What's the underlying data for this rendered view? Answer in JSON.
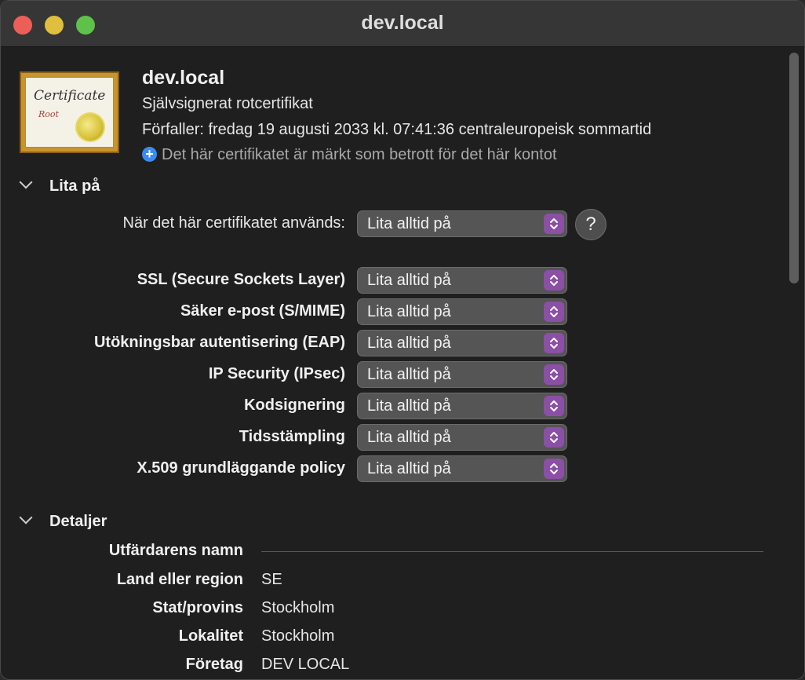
{
  "window": {
    "title": "dev.local"
  },
  "certificate": {
    "icon_title": "Certificate",
    "icon_subtitle": "Root",
    "name": "dev.local",
    "kind": "Självsignerat rotcertifikat",
    "expiry": "Förfaller: fredag 19 augusti 2033 kl. 07:41:36 centraleuropeisk sommartid",
    "trust_note": "Det här certifikatet är märkt som betrott för det här kontot"
  },
  "trust": {
    "section_title": "Lita på",
    "when_used_label": "När det här certifikatet används:",
    "when_used_value": "Lita alltid på",
    "help_label": "?",
    "policies": [
      {
        "label": "SSL (Secure Sockets Layer)",
        "value": "Lita alltid på"
      },
      {
        "label": "Säker e-post (S/MIME)",
        "value": "Lita alltid på"
      },
      {
        "label": "Utökningsbar autentisering (EAP)",
        "value": "Lita alltid på"
      },
      {
        "label": "IP Security (IPsec)",
        "value": "Lita alltid på"
      },
      {
        "label": "Kodsignering",
        "value": "Lita alltid på"
      },
      {
        "label": "Tidsstämpling",
        "value": "Lita alltid på"
      },
      {
        "label": "X.509 grundläggande policy",
        "value": "Lita alltid på"
      }
    ]
  },
  "details": {
    "section_title": "Detaljer",
    "issuer_heading": "Utfärdarens namn",
    "rows": [
      {
        "label": "Land eller region",
        "value": "SE"
      },
      {
        "label": "Stat/provins",
        "value": "Stockholm"
      },
      {
        "label": "Lokalitet",
        "value": "Stockholm"
      },
      {
        "label": "Företag",
        "value": "DEV LOCAL"
      }
    ]
  },
  "colors": {
    "accent_stepper": "#8b4fa6",
    "info_blue": "#3b8cf2",
    "close": "#ec5f58",
    "minimize": "#e0bf3e",
    "maximize": "#5fc149"
  }
}
